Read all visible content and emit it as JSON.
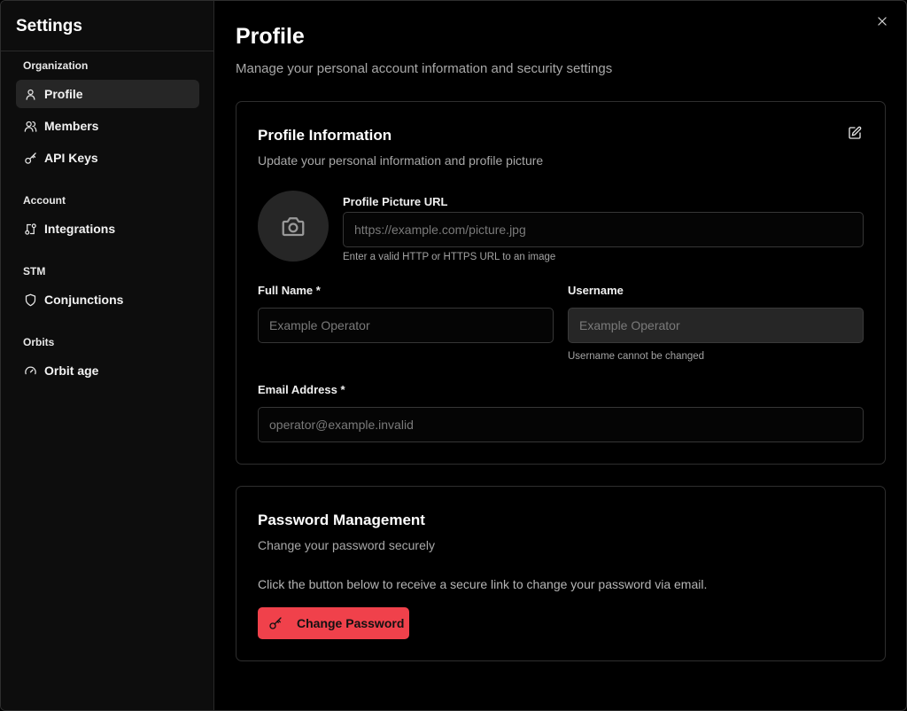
{
  "sidebar": {
    "title": "Settings",
    "sections": [
      {
        "label": "Organization"
      },
      {
        "label": "Account"
      },
      {
        "label": "STM"
      },
      {
        "label": "Orbits"
      }
    ],
    "items": [
      {
        "label": "Profile",
        "icon": "user-icon",
        "active": true
      },
      {
        "label": "Members",
        "icon": "users-icon"
      },
      {
        "label": "API Keys",
        "icon": "key-icon"
      },
      {
        "label": "Integrations",
        "icon": "integration-icon"
      },
      {
        "label": "Conjunctions",
        "icon": "shield-icon"
      },
      {
        "label": "Orbit age",
        "icon": "gauge-icon"
      }
    ]
  },
  "header": {
    "title": "Profile",
    "subtitle": "Manage your personal account information and security settings",
    "close_icon": "close-icon"
  },
  "profile_card": {
    "title": "Profile Information",
    "subtitle": "Update your personal information and profile picture",
    "edit_icon": "edit-icon",
    "avatar_icon": "camera-icon",
    "picture_url": {
      "label": "Profile Picture URL",
      "value": "",
      "placeholder": "https://example.com/picture.jpg",
      "hint": "Enter a valid HTTP or HTTPS URL to an image"
    },
    "full_name": {
      "label": "Full Name *",
      "value": "",
      "placeholder": "Example Operator"
    },
    "username": {
      "label": "Username",
      "value": "",
      "placeholder": "Example Operator",
      "hint": "Username cannot be changed",
      "disabled": true
    },
    "email": {
      "label": "Email Address *",
      "value": "",
      "placeholder": "operator@example.invalid"
    }
  },
  "password_card": {
    "title": "Password Management",
    "subtitle": "Change your password securely",
    "description": "Click the button below to receive a secure link to change your password via email.",
    "button_label": "Change Password",
    "button_icon": "key-icon",
    "button_color": "#f0414b"
  }
}
